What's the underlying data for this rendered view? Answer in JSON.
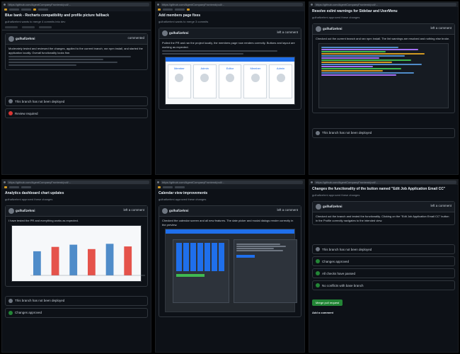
{
  "panels": [
    {
      "url": "https://github.com/AgentCompanyFrontend/pull/...",
      "title": "Blue bank - Recharts compatibility and profile picture fallback",
      "meta": "gulhafizehmi wants to merge 4 commits into dev",
      "commenter": "gulhafizehmi",
      "comment_time": "commented",
      "comment_text": "Moderately tested and reviewed the changes, applied to the current branch, ran npm install, and started the application locally. Overall functionality looks fine.",
      "statuses": [
        {
          "label": "This branch has not been deployed",
          "tone": "gray"
        },
        {
          "label": "Review required",
          "tone": "red"
        }
      ]
    },
    {
      "url": "https://github.com/AgentCompanyFrontend/pull/...",
      "title": "Add members page fixes",
      "meta": "gulhafizehmi wants to merge 3 commits",
      "commenter": "gulhafizehmi",
      "comment_time": "left a comment",
      "comment_text": "Pulled the PR and ran the project locally, the members page now renders correctly. Buttons and layout are working as expected.",
      "cards": [
        "Member",
        "Admin",
        "Editor",
        "Member",
        "Admin"
      ],
      "statuses": []
    },
    {
      "url": "https://github.com/AgentCompanyFrontend/pull/...",
      "title": "Resolve eslint warnings for Sidebar and UserMenu",
      "meta": "gulhafizehmi approved these changes",
      "commenter": "gulhafizehmi",
      "comment_time": "left a comment",
      "comment_text": "Checked out the current branch and ran npm install. The lint warnings are resolved and nothing else broke.",
      "statuses": [
        {
          "label": "This branch has not been deployed",
          "tone": "gray"
        }
      ]
    },
    {
      "url": "https://github.com/AgentCompanyFrontend/pull/...",
      "title": "Analytics dashboard chart updates",
      "meta": "gulhafizehmi approved these changes",
      "commenter": "gulhafizehmi",
      "comment_time": "left a comment",
      "comment_text": "I have tested the PR and everything works as expected.",
      "chart_bars": [
        0.55,
        0.65,
        0.7,
        0.6,
        0.72,
        0.66
      ],
      "statuses": [
        {
          "label": "This branch has not been deployed",
          "tone": "gray"
        },
        {
          "label": "Changes approved",
          "tone": "green"
        }
      ]
    },
    {
      "url": "https://github.com/AgentCompanyFrontend/pull/...",
      "title": "Calendar view improvements",
      "meta": "gulhafizehmi approved these changes",
      "commenter": "gulhafizehmi",
      "comment_time": "left a comment",
      "comment_text": "Checked the calendar screen and all new features. The date picker and modal dialogs render correctly in the preview.",
      "statuses": []
    },
    {
      "url": "https://github.com/AgentCompanyFrontend/pull/...",
      "title": "Changes the functionality of the button named \"Edit Job Application Email CC\"",
      "meta": "gulhafizehmi approved these changes",
      "commenter": "gulhafizehmi",
      "comment_time": "left a comment",
      "comment_text": "Checked out the branch and tested the functionality. Clicking on the \"Edit Job Application Email CC\" button in the Profile correctly navigates to the intended view.",
      "statuses": [
        {
          "label": "This branch has not been deployed",
          "tone": "gray"
        },
        {
          "label": "Changes approved",
          "tone": "green"
        },
        {
          "label": "All checks have passed",
          "tone": "green"
        },
        {
          "label": "No conflicts with base branch",
          "tone": "green"
        }
      ],
      "merge_label": "Merge pull request",
      "add_comment": "Add a comment"
    }
  ]
}
